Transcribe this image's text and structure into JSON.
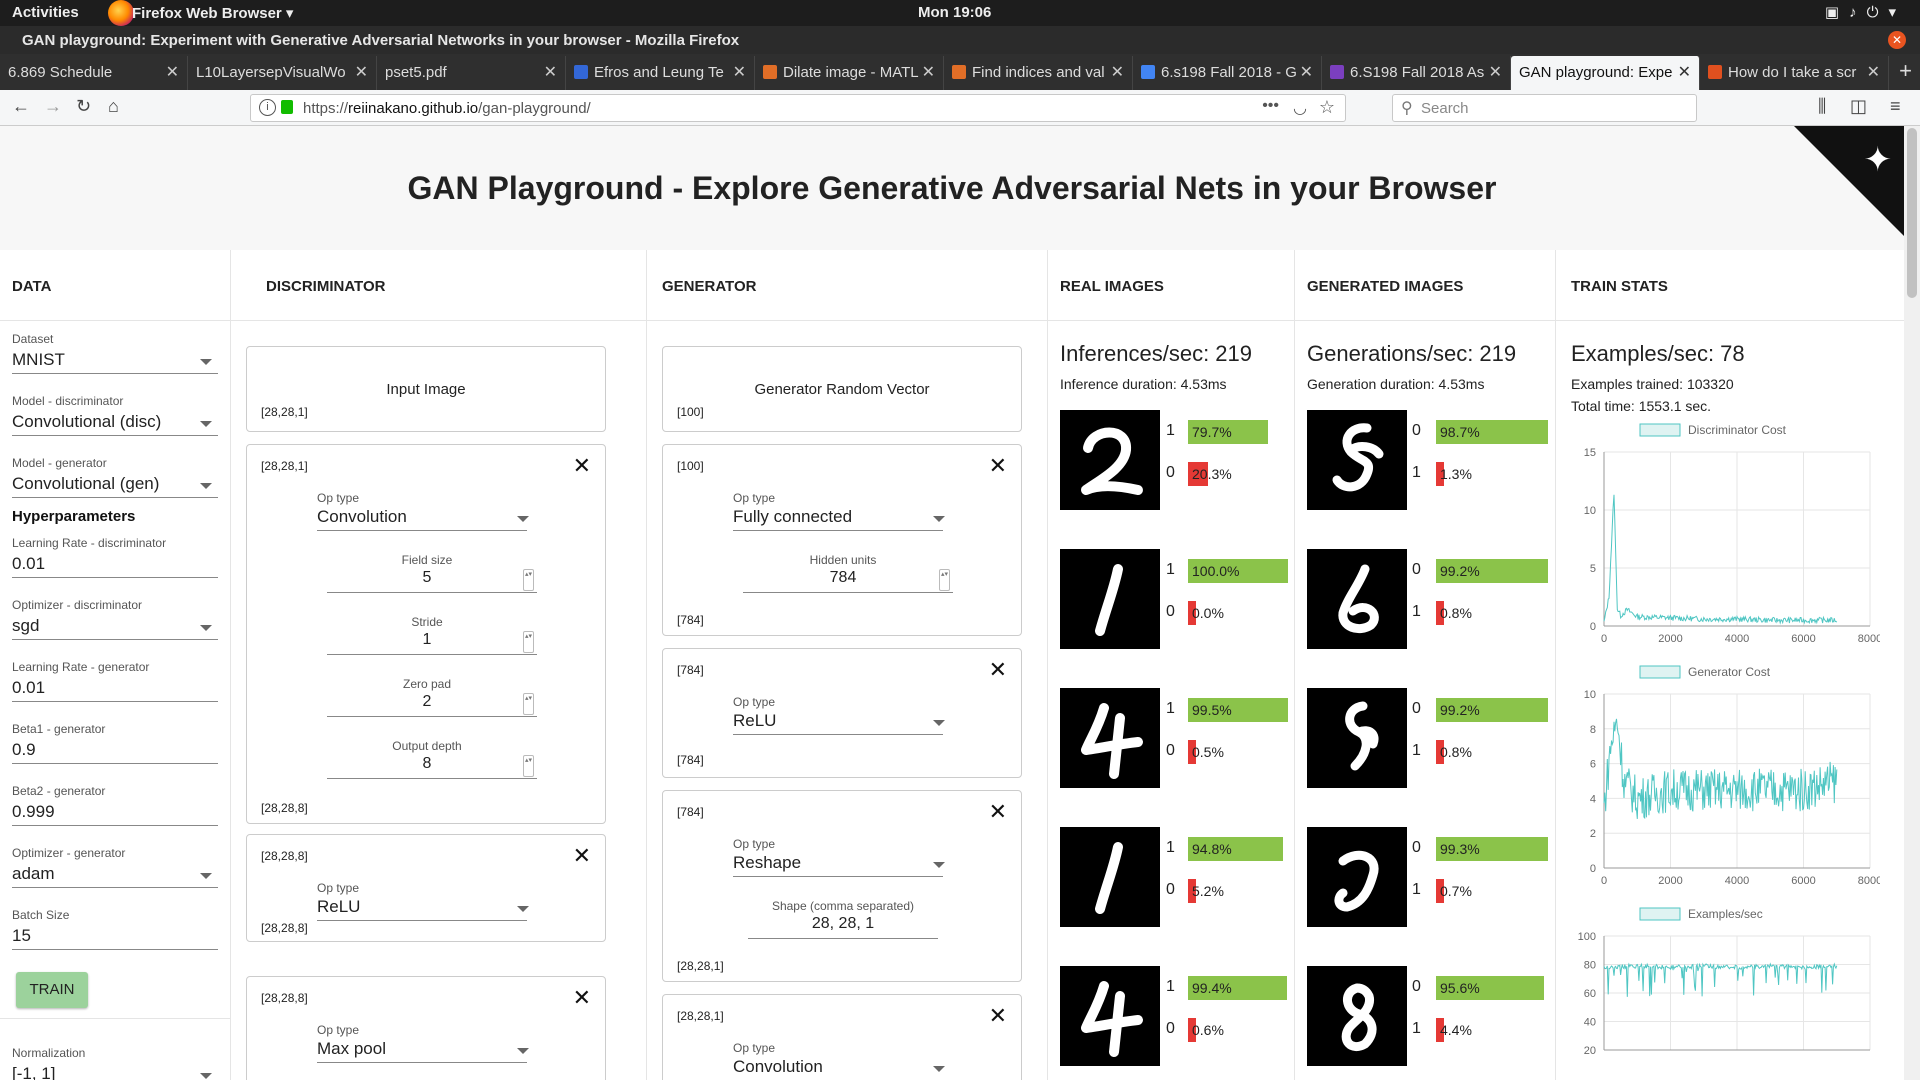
{
  "os": {
    "activities": "Activities",
    "app_name": "Firefox Web Browser ▾",
    "clock": "Mon 19:06"
  },
  "window": {
    "title": "GAN playground: Experiment with Generative Adversarial Networks in your browser - Mozilla Firefox"
  },
  "tabs": [
    {
      "label": "6.869 Schedule",
      "icon_color": ""
    },
    {
      "label": "L10LayersepVisualWo",
      "icon_color": ""
    },
    {
      "label": "pset5.pdf",
      "icon_color": ""
    },
    {
      "label": "Efros and Leung Te",
      "icon_color": "#3367d6"
    },
    {
      "label": "Dilate image - MATL",
      "icon_color": "#e16e27"
    },
    {
      "label": "Find indices and val",
      "icon_color": "#e16e27"
    },
    {
      "label": "6.s198 Fall 2018 - G",
      "icon_color": "#4285f4"
    },
    {
      "label": "6.S198 Fall 2018 As",
      "icon_color": "#7b3fbf"
    },
    {
      "label": "GAN playground: Expe",
      "icon_color": ""
    },
    {
      "label": "How do I take a scr",
      "icon_color": "#e0501f"
    }
  ],
  "nav": {
    "url_prefix": "https://",
    "url_host": "reiinakano.github.io",
    "url_path": "/gan-playground/",
    "search_placeholder": "Search"
  },
  "page": {
    "title": "GAN Playground - Explore Generative Adversarial Nets in your Browser"
  },
  "columns": {
    "data": "DATA",
    "discriminator": "DISCRIMINATOR",
    "generator": "GENERATOR",
    "real": "REAL IMAGES",
    "generated": "GENERATED IMAGES",
    "train": "TRAIN STATS"
  },
  "data_panel": {
    "dataset_label": "Dataset",
    "dataset": "MNIST",
    "model_disc_label": "Model - discriminator",
    "model_disc": "Convolutional (disc)",
    "model_gen_label": "Model - generator",
    "model_gen": "Convolutional (gen)",
    "hyper": "Hyperparameters",
    "lr_disc_label": "Learning Rate - discriminator",
    "lr_disc": "0.01",
    "opt_disc_label": "Optimizer - discriminator",
    "opt_disc": "sgd",
    "lr_gen_label": "Learning Rate - generator",
    "lr_gen": "0.01",
    "beta1_label": "Beta1 - generator",
    "beta1": "0.9",
    "beta2_label": "Beta2 - generator",
    "beta2": "0.999",
    "opt_gen_label": "Optimizer - generator",
    "opt_gen": "adam",
    "batch_label": "Batch Size",
    "batch": "15",
    "train": "TRAIN",
    "norm_label": "Normalization",
    "norm": "[-1, 1]"
  },
  "disc": {
    "input_title": "Input Image",
    "input_shape": "[28,28,1]",
    "l1_in": "[28,28,1]",
    "l1_op_label": "Op type",
    "l1_op": "Convolution",
    "l1_f1_label": "Field size",
    "l1_f1": "5",
    "l1_f2_label": "Stride",
    "l1_f2": "1",
    "l1_f3_label": "Zero pad",
    "l1_f3": "2",
    "l1_f4_label": "Output depth",
    "l1_f4": "8",
    "l1_out": "[28,28,8]",
    "l2_in": "[28,28,8]",
    "l2_op_label": "Op type",
    "l2_op": "ReLU",
    "l2_out": "[28,28,8]",
    "l3_in": "[28,28,8]",
    "l3_op_label": "Op type",
    "l3_op": "Max pool"
  },
  "gen": {
    "input_title": "Generator Random Vector",
    "input_shape": "[100]",
    "l1_in": "[100]",
    "l1_op_label": "Op type",
    "l1_op": "Fully connected",
    "l1_f1_label": "Hidden units",
    "l1_f1": "784",
    "l1_out": "[784]",
    "l2_in": "[784]",
    "l2_op_label": "Op type",
    "l2_op": "ReLU",
    "l2_out": "[784]",
    "l3_in": "[784]",
    "l3_op_label": "Op type",
    "l3_op": "Reshape",
    "l3_f1_label": "Shape (comma separated)",
    "l3_f1": "28, 28, 1",
    "l3_out": "[28,28,1]",
    "l4_in": "[28,28,1]",
    "l4_op_label": "Op type",
    "l4_op": "Convolution"
  },
  "real": {
    "stat": "Inferences/sec: 219",
    "duration": "Inference duration: 4.53ms",
    "rows": [
      {
        "digit": "2",
        "p1": "1",
        "v1": "79.7%",
        "f1": 0.797,
        "p0": "0",
        "v0": "20.3%",
        "f0": 0.203
      },
      {
        "digit": "1",
        "p1": "1",
        "v1": "100.0%",
        "f1": 1.0,
        "p0": "0",
        "v0": "0.0%",
        "f0": 0.0
      },
      {
        "digit": "4",
        "p1": "1",
        "v1": "99.5%",
        "f1": 0.995,
        "p0": "0",
        "v0": "0.5%",
        "f0": 0.005
      },
      {
        "digit": "1",
        "p1": "1",
        "v1": "94.8%",
        "f1": 0.948,
        "p0": "0",
        "v0": "5.2%",
        "f0": 0.052
      },
      {
        "digit": "4",
        "p1": "1",
        "v1": "99.4%",
        "f1": 0.994,
        "p0": "0",
        "v0": "0.6%",
        "f0": 0.006
      }
    ]
  },
  "generated": {
    "stat": "Generations/sec: 219",
    "duration": "Generation duration: 4.53ms",
    "rows": [
      {
        "p1": "0",
        "v1": "98.7%",
        "f1": 0.987,
        "p0": "1",
        "v0": "1.3%",
        "f0": 0.013
      },
      {
        "p1": "0",
        "v1": "99.2%",
        "f1": 0.992,
        "p0": "1",
        "v0": "0.8%",
        "f0": 0.008
      },
      {
        "p1": "0",
        "v1": "99.2%",
        "f1": 0.992,
        "p0": "1",
        "v0": "0.8%",
        "f0": 0.008
      },
      {
        "p1": "0",
        "v1": "99.3%",
        "f1": 0.993,
        "p0": "1",
        "v0": "0.7%",
        "f0": 0.007
      },
      {
        "p1": "0",
        "v1": "95.6%",
        "f1": 0.956,
        "p0": "1",
        "v0": "4.4%",
        "f0": 0.044
      }
    ]
  },
  "train": {
    "stat": "Examples/sec: 78",
    "trained": "Examples trained: 103320",
    "total": "Total time: 1553.1 sec."
  },
  "colors": {
    "green": "#8bc34a",
    "red": "#e53935",
    "teal": "#4fc6c3"
  },
  "chart_data": [
    {
      "type": "line",
      "title": "Discriminator Cost",
      "x_ticks": [
        "0",
        "2000",
        "4000",
        "6000",
        "8000"
      ],
      "y_ticks": [
        "0",
        "5",
        "10",
        "15"
      ],
      "xlim": [
        0,
        8000
      ],
      "ylim": [
        0,
        15
      ],
      "grid": true,
      "legend": "top",
      "series": [
        {
          "name": "Discriminator Cost",
          "x": [
            0,
            150,
            300,
            400,
            500,
            700,
            1000,
            2000,
            3000,
            4000,
            5000,
            6000,
            7000
          ],
          "y": [
            0.3,
            2.5,
            11.5,
            1.5,
            0.9,
            1.4,
            0.8,
            0.7,
            0.6,
            0.6,
            0.5,
            0.5,
            0.5
          ]
        }
      ]
    },
    {
      "type": "line",
      "title": "Generator Cost",
      "x_ticks": [
        "0",
        "2000",
        "4000",
        "6000",
        "8000"
      ],
      "y_ticks": [
        "0",
        "2",
        "4",
        "6",
        "8",
        "10"
      ],
      "xlim": [
        0,
        8000
      ],
      "ylim": [
        0,
        10
      ],
      "grid": true,
      "legend": "top",
      "series": [
        {
          "name": "Generator Cost",
          "x": [
            0,
            200,
            400,
            600,
            1000,
            2000,
            3000,
            4000,
            5000,
            6000,
            7000
          ],
          "y": [
            3.5,
            7.0,
            8.5,
            5.0,
            4.0,
            4.5,
            4.5,
            4.5,
            4.5,
            4.5,
            5.0
          ]
        }
      ]
    },
    {
      "type": "line",
      "title": "Examples/sec",
      "x_ticks": [],
      "y_ticks": [
        "20",
        "40",
        "60",
        "80",
        "100"
      ],
      "ylim": [
        20,
        100
      ],
      "grid": true,
      "legend": "top",
      "series": [
        {
          "name": "Examples/sec",
          "x": [
            0,
            1000,
            2000,
            3000,
            4000,
            5000,
            6000,
            7000
          ],
          "y": [
            78,
            79,
            78,
            79,
            78,
            79,
            78,
            79
          ]
        }
      ]
    }
  ]
}
